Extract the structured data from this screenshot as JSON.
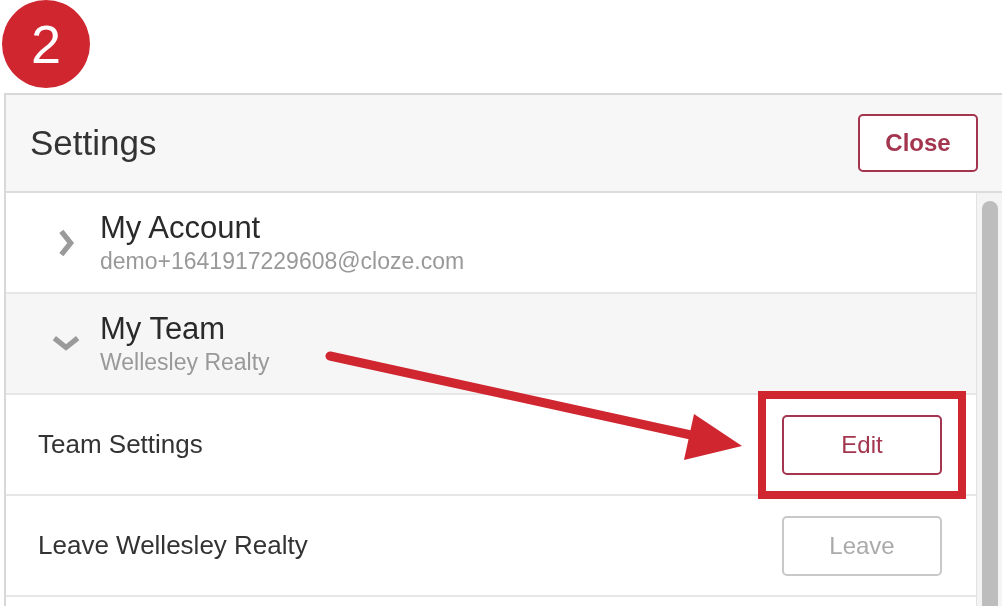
{
  "step_badge": "2",
  "header": {
    "title": "Settings",
    "close_button": "Close"
  },
  "sections": [
    {
      "title": "My Account",
      "subtitle": "demo+1641917229608@cloze.com",
      "expanded": false
    },
    {
      "title": "My Team",
      "subtitle": "Wellesley Realty",
      "expanded": true,
      "items": [
        {
          "label": "Team Settings",
          "button": "Edit",
          "disabled": false,
          "highlighted": true
        },
        {
          "label": "Leave Wellesley Realty",
          "button": "Leave",
          "disabled": true,
          "highlighted": false
        }
      ]
    }
  ]
}
